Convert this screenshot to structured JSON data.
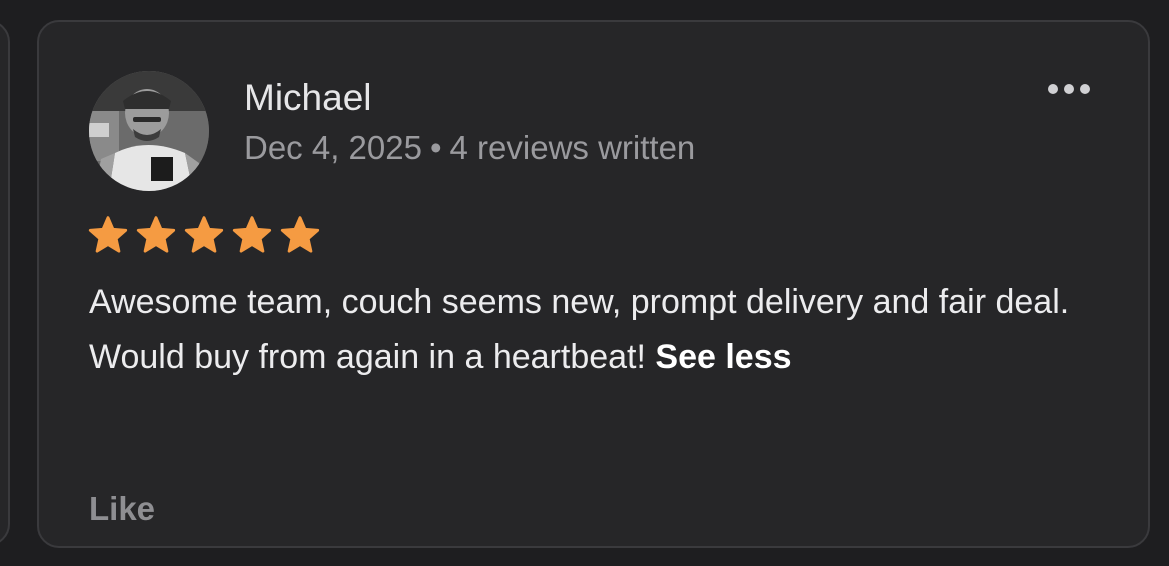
{
  "review": {
    "author_name": "Michael",
    "date": "Dec 4, 2025",
    "separator": "•",
    "reviews_written": "4 reviews written",
    "rating": 5,
    "rating_max": 5,
    "text": "Awesome team, couch seems new, prompt delivery and fair deal. Would buy from again in a heartbeat!",
    "see_less_label": "See less",
    "like_label": "Like",
    "more_icon": "more-horizontal-icon",
    "star_icon": "star-icon"
  },
  "colors": {
    "background": "#1e1e20",
    "card": "#262628",
    "card_border": "#3a3a3d",
    "star": "#f59b42",
    "primary_text": "#ececee",
    "secondary_text": "#9a9a9e"
  }
}
